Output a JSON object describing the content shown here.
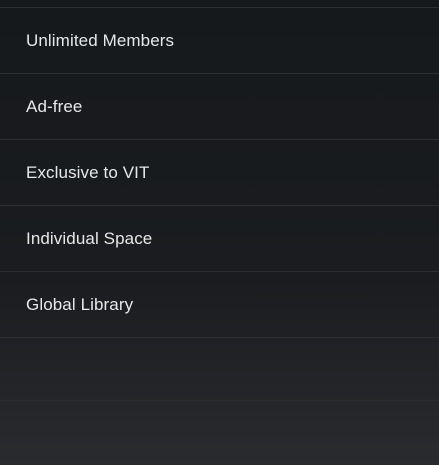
{
  "features": [
    {
      "label": "Unlimited Members"
    },
    {
      "label": "Ad-free"
    },
    {
      "label": "Exclusive to VIT"
    },
    {
      "label": "Individual Space"
    },
    {
      "label": "Global Library"
    }
  ]
}
